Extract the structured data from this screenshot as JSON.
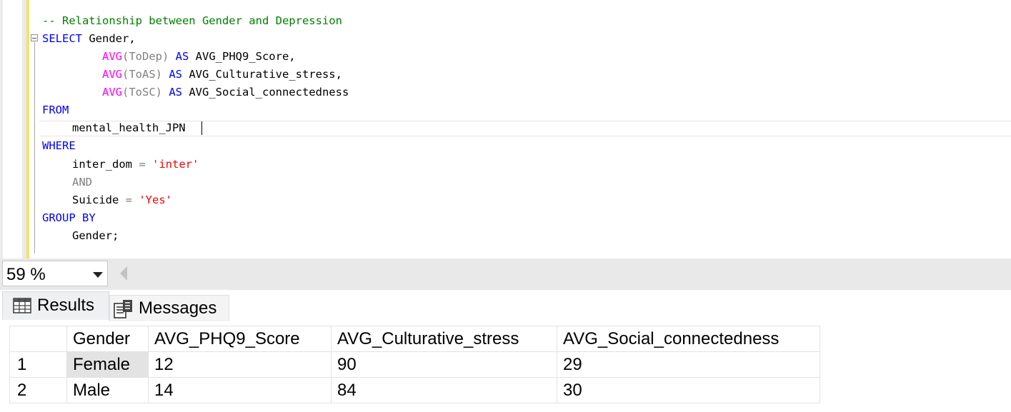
{
  "editor": {
    "lines": {
      "l1_comment": "-- Relationship between Gender and Depression",
      "l2_select": "SELECT",
      "l2_rest": " Gender,",
      "l3_fn": "AVG",
      "l3_arg": "(ToDep)",
      "l3_as": " AS",
      "l3_alias": " AVG_PHQ9_Score,",
      "l4_fn": "AVG",
      "l4_arg": "(ToAS)",
      "l4_as": " AS",
      "l4_alias": " AVG_Culturative_stress,",
      "l5_fn": "AVG",
      "l5_arg": "(ToSC)",
      "l5_as": " AS",
      "l5_alias": " AVG_Social_connectedness",
      "l6_from": "FROM",
      "l7_table": "mental_health_JPN",
      "l8_where": "WHERE",
      "l9_col": "inter_dom",
      "l9_op": " =",
      "l9_val": " 'inter'",
      "l10_and": "AND",
      "l11_col": "Suicide",
      "l11_op": " =",
      "l11_val": " 'Yes'",
      "l12_group": "GROUP BY",
      "l13_col": "Gender;"
    }
  },
  "statusbar": {
    "zoom": "59 %"
  },
  "tabs": {
    "results": "Results",
    "messages": "Messages"
  },
  "results": {
    "columns": [
      "",
      "Gender",
      "AVG_PHQ9_Score",
      "AVG_Culturative_stress",
      "AVG_Social_connectedness"
    ],
    "rows": [
      {
        "num": "1",
        "gender": "Female",
        "phq9": "12",
        "stress": "90",
        "social": "29"
      },
      {
        "num": "2",
        "gender": "Male",
        "phq9": "14",
        "stress": "84",
        "social": "30"
      }
    ]
  },
  "colors": {
    "keyword": "#0000ff",
    "function": "#ff00ff",
    "comment": "#008000",
    "string": "#ff0000",
    "operator": "#808080"
  },
  "icons": {
    "collapse": "collapse-minus-icon",
    "zoom_dropdown": "chevron-down-icon",
    "scroll": "scroll-left-arrow-icon",
    "results_tab": "grid-table-icon",
    "messages_tab": "messages-document-icon"
  }
}
